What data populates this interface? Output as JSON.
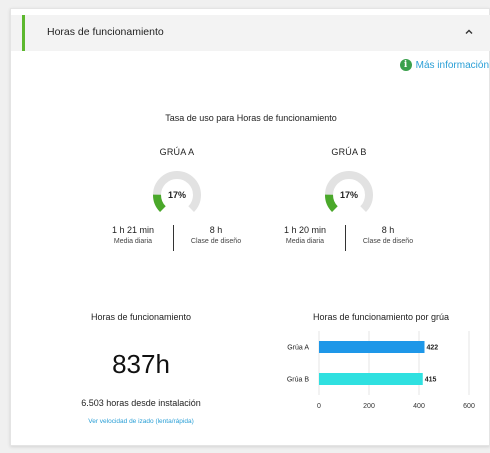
{
  "header": {
    "title": "Horas de funcionamiento"
  },
  "more_info": {
    "label": "Más información"
  },
  "usage": {
    "title": "Tasa de uso para Horas de funcionamiento",
    "cranes": [
      {
        "name": "GRÚA A",
        "percent": 17,
        "percent_label": "17%",
        "daily_value": "1 h 21 min",
        "daily_label": "Media diaria",
        "design_value": "8 h",
        "design_label": "Clase de diseño"
      },
      {
        "name": "GRÚA B",
        "percent": 17,
        "percent_label": "17%",
        "daily_value": "1 h 20 min",
        "daily_label": "Media diaria",
        "design_value": "8 h",
        "design_label": "Clase de diseño"
      }
    ]
  },
  "runtime": {
    "title": "Horas de funcionamiento",
    "total": "837h",
    "since_install": "6.503 horas desde instalación",
    "speed_link": "Ver velocidad de izado (lenta/rápida)"
  },
  "colors": {
    "accent": "#5cb82e",
    "gauge_fill": "#4aa82a",
    "gauge_track": "#e2e2e2",
    "bar_a": "#1e97e8",
    "bar_b": "#2fe0e0",
    "link": "#2a9fd6"
  },
  "chart_data": {
    "type": "bar",
    "orientation": "horizontal",
    "title": "Horas de funcionamiento por grúa",
    "categories": [
      "Grúa A",
      "Grúa B"
    ],
    "values": [
      422,
      415
    ],
    "value_labels": [
      "422",
      "415"
    ],
    "xlim": [
      0,
      600
    ],
    "xticks": [
      0,
      200,
      400,
      600
    ],
    "xtick_labels": [
      "0",
      "200",
      "400",
      "600"
    ],
    "grid": true
  }
}
